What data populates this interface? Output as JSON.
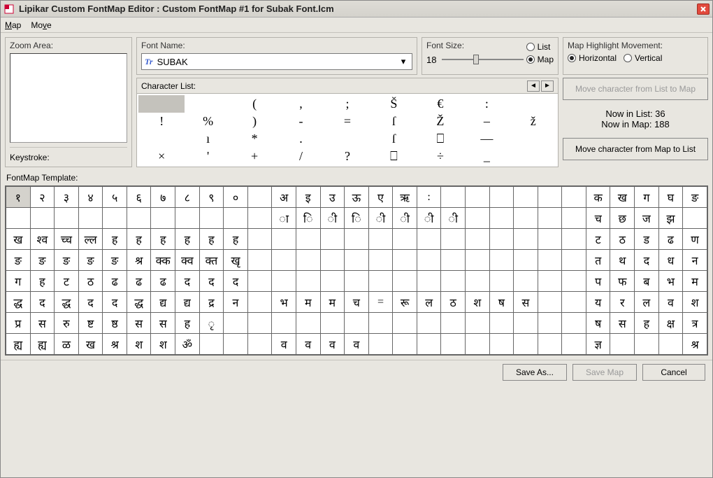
{
  "titlebar": {
    "app": "Lipikar Custom FontMap Editor :  Custom FontMap #1 for Subak Font.lcm"
  },
  "menubar": {
    "m1": "Map",
    "m1_u": "M",
    "m2": "Move",
    "m2_u": "v"
  },
  "zoom": {
    "label": "Zoom Area:"
  },
  "keystroke": {
    "label": "Keystroke:"
  },
  "fontname": {
    "label": "Font Name:",
    "value": "SUBAK"
  },
  "fontsize": {
    "label": "Font Size:",
    "value": "18",
    "list": "List",
    "map": "Map"
  },
  "highlight": {
    "label": "Map Highlight Movement:",
    "h": "Horizontal",
    "v": "Vertical"
  },
  "charlist": {
    "label": "Character List:",
    "cells": [
      "",
      "",
      "(",
      ",",
      ";",
      "Š",
      "€",
      ":",
      "",
      "!",
      "%",
      ")",
      "-",
      "=",
      "ſ",
      "Ž",
      "–",
      "ž",
      "",
      "ı",
      "*",
      ".",
      "",
      "ſ",
      "⎕",
      "—",
      "",
      "×",
      "'",
      "+",
      "/",
      "?",
      "⎕",
      "÷",
      "_",
      ""
    ]
  },
  "right": {
    "moveToMap": "Move character from List to Map",
    "moveToList": "Move character from Map to List",
    "listCount": "Now in List:  36",
    "mapCount": "Now in Map: 188"
  },
  "template": {
    "label": "FontMap Template:"
  },
  "grid": {
    "cols": 29,
    "rows": [
      [
        "१",
        "२",
        "३",
        "४",
        "५",
        "६",
        "७",
        "८",
        "९",
        "०",
        "",
        "अ",
        "इ",
        "उ",
        "ऊ",
        "ए",
        "ऋ",
        ":",
        "",
        "",
        "",
        "",
        "",
        "",
        "क",
        "ख",
        "ग",
        "घ",
        "ङ"
      ],
      [
        "",
        "",
        "",
        "",
        "",
        "",
        "",
        "",
        "",
        "",
        "",
        "ा",
        "ि",
        "ी",
        "ि",
        "ी",
        "ी",
        "ी",
        "ी",
        "",
        "",
        "",
        "",
        "",
        "च",
        "छ",
        "ज",
        "झ",
        ""
      ],
      [
        "ख",
        "श्व",
        "च्च",
        "ल्ल",
        "ह",
        "ह",
        "ह",
        "ह",
        "ह",
        "ह",
        "",
        "",
        "",
        "",
        "",
        "",
        "",
        "",
        "",
        "",
        "",
        "",
        "",
        "",
        "ट",
        "ठ",
        "ड",
        "ढ",
        "ण"
      ],
      [
        "ङ",
        "ङ",
        "ङ",
        "ङ",
        "ङ",
        "श्र",
        "क्क",
        "क्व",
        "क्त",
        "खृ",
        "",
        "",
        "",
        "",
        "",
        "",
        "",
        "",
        "",
        "",
        "",
        "",
        "",
        "",
        "त",
        "थ",
        "द",
        "ध",
        "न"
      ],
      [
        "ग",
        "ह",
        "ट",
        "ठ",
        "ढ",
        "ढ",
        "ढ",
        "द",
        "द",
        "द",
        "",
        "",
        "",
        "",
        "",
        "",
        "",
        "",
        "",
        "",
        "",
        "",
        "",
        "",
        "प",
        "फ",
        "ब",
        "भ",
        "म"
      ],
      [
        "द्ध",
        "द",
        "द्ध",
        "द",
        "द",
        "द्ध",
        "द्य",
        "द्य",
        "द्र",
        "न",
        "",
        "भ",
        "म",
        "म",
        "च",
        "=",
        "रू",
        "ल",
        "ठ",
        "श",
        "ष",
        "स",
        "",
        "",
        "य",
        "र",
        "ल",
        "व",
        "श"
      ],
      [
        "प्र",
        "स",
        "रु",
        "ष्ट",
        "ष्ठ",
        "स",
        "स",
        "ह",
        "ृ",
        "",
        "",
        "",
        "",
        "",
        "",
        "",
        "",
        "",
        "",
        "",
        "",
        "",
        "",
        "",
        "ष",
        "स",
        "ह",
        "क्ष",
        "त्र"
      ],
      [
        "ह्य",
        "ह्य",
        "ळ",
        "ख",
        "श्र",
        "श",
        "श",
        "ॐ",
        "",
        "",
        "",
        "व",
        "व",
        "व",
        "व",
        "",
        "",
        "",
        "",
        "",
        "",
        "",
        "",
        "",
        "ज्ञ",
        "",
        "",
        "",
        "श्र"
      ]
    ]
  },
  "footer": {
    "saveAs": "Save As...",
    "saveMap": "Save Map",
    "cancel": "Cancel"
  }
}
